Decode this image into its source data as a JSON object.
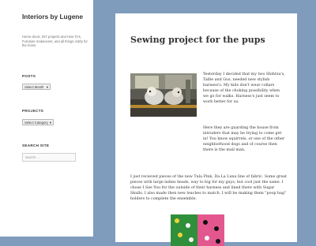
{
  "site": {
    "title": "Interiors by Lugene",
    "description": "Home decor, DIY projects and How To's, Furniture makeovers, and all things crafty for the home"
  },
  "widgets": {
    "posts": {
      "title": "POSTS",
      "select_value": "Select Month"
    },
    "projects": {
      "title": "PROJECTS",
      "select_value": "Select Category"
    },
    "search": {
      "title": "SEARCH SITE",
      "placeholder": "Search …"
    }
  },
  "post": {
    "title": "Sewing project for the pups",
    "paragraph1": "Yesterday I decided that my two Shihtzu's, Tallie and Gus, needed new stylish harness's.  My kids don't wear collars because of the choking possibility when we go for walks.  Harness's just seem to work better for us.",
    "paragraph2": "Here they are guarding the house from intruders that may be trying to come get in! You know squirrels, or one of the other neighborhood dogs and of course then there is the mail man.",
    "paragraph3": "I just recieved pieces of the new Tula Pink, Da La Luna line of fabric.  Some great pieces with large ladies heads, way to big for my guys, but cool just the same. I chose I See You for the outside of their harness and lined there with Sugar Skulls.  I also made then new leaches to match.  I will be making them \"poop bag\" holders to complete the ensemble."
  },
  "icons": {
    "select_arrow": "chevron-down-icon",
    "post_image": "dogs-photo",
    "fabric_image": "fabric-photo"
  },
  "colors": {
    "page_background": "#7f9cbd",
    "sidebar_background": "#ffffff",
    "text": "#333333"
  }
}
